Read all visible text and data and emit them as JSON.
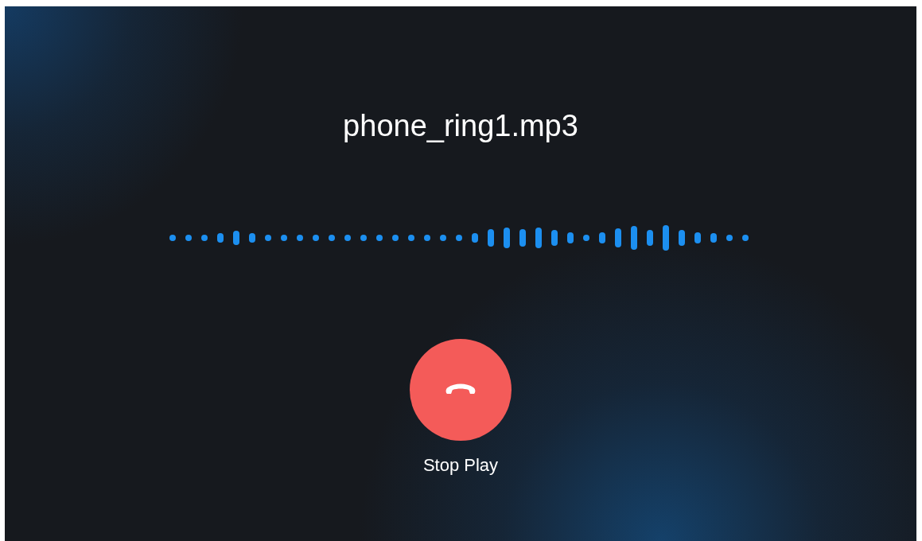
{
  "title": "phone_ring1.mp3",
  "stop_button": {
    "label": "Stop Play"
  }
}
